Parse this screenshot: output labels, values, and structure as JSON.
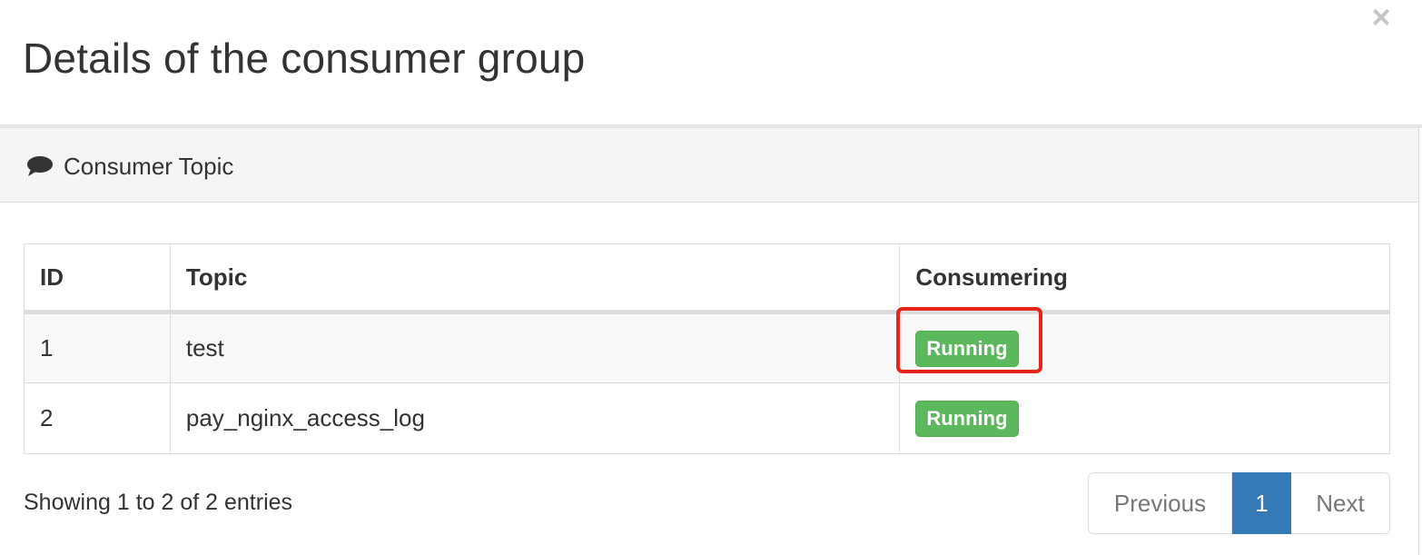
{
  "modal": {
    "title": "Details of the consumer group",
    "close_label": "×"
  },
  "panel": {
    "icon": "comment-icon",
    "title": "Consumer Topic"
  },
  "table": {
    "headers": [
      "ID",
      "Topic",
      "Consumering"
    ],
    "rows": [
      {
        "id": "1",
        "topic": "test",
        "status": "Running"
      },
      {
        "id": "2",
        "topic": "pay_nginx_access_log",
        "status": "Running"
      }
    ]
  },
  "footer": {
    "info": "Showing 1 to 2 of 2 entries",
    "pagination": {
      "previous": "Previous",
      "current_page": "1",
      "next": "Next"
    }
  },
  "colors": {
    "running_badge": "#5cb85c",
    "active_page": "#337ab7",
    "highlight_box": "#e8231a"
  }
}
